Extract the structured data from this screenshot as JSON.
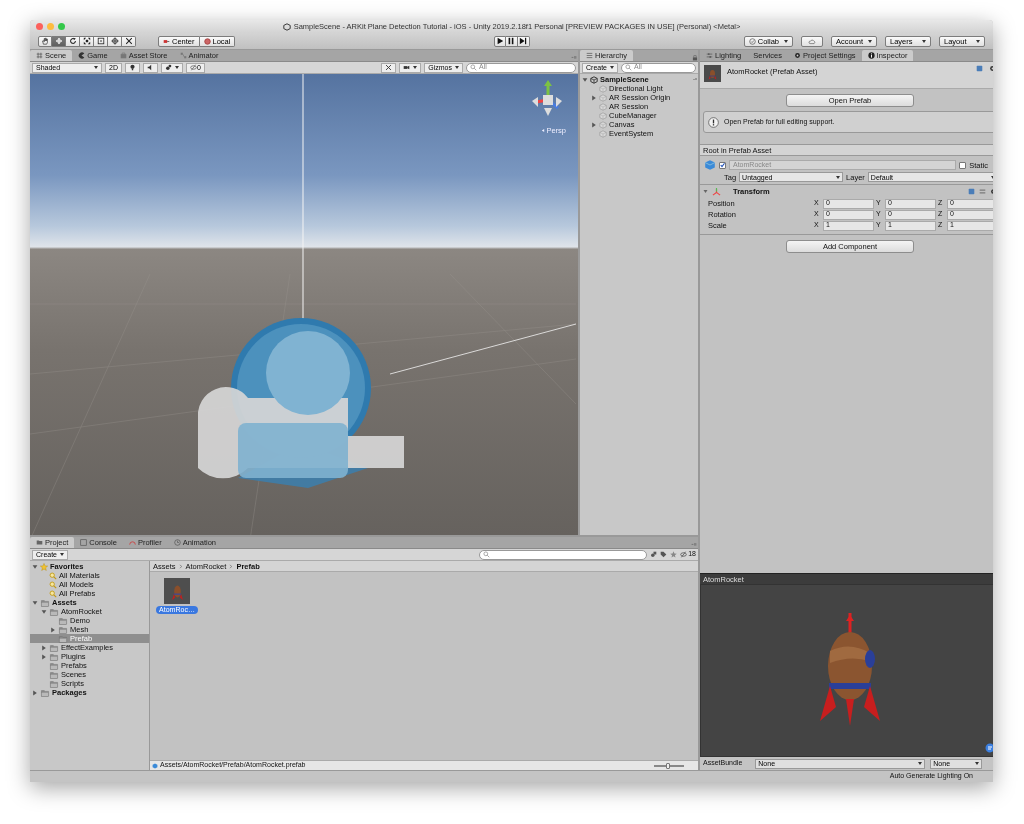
{
  "window": {
    "title": "SampleScene - ARKit Plane Detection Tutorial - iOS - Unity 2019.2.18f1 Personal [PREVIEW PACKAGES IN USE] (Personal) <Metal>"
  },
  "toolbar": {
    "tools": [
      {
        "kind": "hand",
        "selected": false
      },
      {
        "kind": "move",
        "selected": true
      },
      {
        "kind": "rotate",
        "selected": false
      },
      {
        "kind": "scale",
        "selected": false
      },
      {
        "kind": "rect",
        "selected": false
      },
      {
        "kind": "transform",
        "selected": false
      },
      {
        "kind": "custom",
        "selected": false
      }
    ],
    "pivot": [
      "Center",
      "Local"
    ],
    "collab": "Collab",
    "account": "Account",
    "layers": "Layers",
    "layout": "Layout"
  },
  "scene_tabs": [
    {
      "label": "Scene",
      "selected": true
    },
    {
      "label": "Game",
      "selected": false
    },
    {
      "label": "Asset Store",
      "selected": false
    },
    {
      "label": "Animator",
      "selected": false
    }
  ],
  "scene_toolbar": {
    "shading": "Shaded",
    "mode_2d": "2D",
    "hidden_count": "0",
    "gizmos": "Gizmos",
    "search_placeholder": "All"
  },
  "scene_view": {
    "persp": "Persp"
  },
  "hierarchy": {
    "tab": "Hierarchy",
    "create": "Create",
    "search_placeholder": "All",
    "tree": [
      {
        "label": "SampleScene",
        "expandable": true,
        "expanded": true,
        "selected": false,
        "children": [
          {
            "label": "Directional Light",
            "expandable": false,
            "selected": false
          },
          {
            "label": "AR Session Origin",
            "expandable": true,
            "expanded": false,
            "selected": false
          },
          {
            "label": "AR Session",
            "expandable": false,
            "selected": false
          },
          {
            "label": "CubeManager",
            "expandable": false,
            "selected": false
          },
          {
            "label": "Canvas",
            "expandable": true,
            "expanded": false,
            "selected": false
          },
          {
            "label": "EventSystem",
            "expandable": false,
            "selected": false
          }
        ]
      }
    ]
  },
  "inspector_tabs": [
    {
      "label": "Lighting",
      "selected": false
    },
    {
      "label": "Services",
      "selected": false
    },
    {
      "label": "Project Settings",
      "selected": false
    },
    {
      "label": "Inspector",
      "selected": true
    }
  ],
  "inspector": {
    "title": "AtomRocket (Prefab Asset)",
    "open_button": "Open Prefab",
    "info": "Open Prefab for full editing support.",
    "root_label": "Root in Prefab Asset",
    "object_name": "AtomRocket",
    "active": true,
    "static_label": "Static",
    "static": false,
    "tag_label": "Tag",
    "tag": "Untagged",
    "layer_label": "Layer",
    "layer": "Default",
    "component": "Transform",
    "rows": [
      {
        "label": "Position",
        "values": [
          {
            "axis": "X",
            "value": "0"
          },
          {
            "axis": "Y",
            "value": "0"
          },
          {
            "axis": "Z",
            "value": "0"
          }
        ]
      },
      {
        "label": "Rotation",
        "values": [
          {
            "axis": "X",
            "value": "0"
          },
          {
            "axis": "Y",
            "value": "0"
          },
          {
            "axis": "Z",
            "value": "0"
          }
        ]
      },
      {
        "label": "Scale",
        "values": [
          {
            "axis": "X",
            "value": "1"
          },
          {
            "axis": "Y",
            "value": "1"
          },
          {
            "axis": "Z",
            "value": "1"
          }
        ]
      }
    ],
    "add_button": "Add Component"
  },
  "project_tabs": [
    {
      "label": "Project",
      "selected": true
    },
    {
      "label": "Console",
      "selected": false
    },
    {
      "label": "Profiler",
      "selected": false
    },
    {
      "label": "Animation",
      "selected": false
    }
  ],
  "project": {
    "create": "Create",
    "hidden_count": "18",
    "tree": [
      {
        "label": "Favorites",
        "kind": "favorites",
        "expandable": true,
        "expanded": true,
        "selected": false,
        "children": [
          {
            "label": "All Materials",
            "kind": "search",
            "expandable": false,
            "selected": false
          },
          {
            "label": "All Models",
            "kind": "search",
            "expandable": false,
            "selected": false
          },
          {
            "label": "All Prefabs",
            "kind": "search",
            "expandable": false,
            "selected": false
          }
        ]
      },
      {
        "label": "Assets",
        "kind": "root",
        "expandable": true,
        "expanded": true,
        "selected": false,
        "children": [
          {
            "label": "AtomRocket",
            "kind": "folder",
            "expandable": true,
            "expanded": true,
            "selected": false,
            "children": [
              {
                "label": "Demo",
                "kind": "folder",
                "expandable": false,
                "selected": false
              },
              {
                "label": "Mesh",
                "kind": "folder",
                "expandable": true,
                "expanded": false,
                "selected": false
              },
              {
                "label": "Prefab",
                "kind": "folder",
                "expandable": false,
                "selected": true
              }
            ]
          },
          {
            "label": "EffectExamples",
            "kind": "folder",
            "expandable": true,
            "expanded": false,
            "selected": false
          },
          {
            "label": "Plugins",
            "kind": "folder",
            "expandable": true,
            "expanded": false,
            "selected": false
          },
          {
            "label": "Prefabs",
            "kind": "folder",
            "expandable": false,
            "selected": false
          },
          {
            "label": "Scenes",
            "kind": "folder",
            "expandable": false,
            "selected": false
          },
          {
            "label": "Scripts",
            "kind": "folder",
            "expandable": false,
            "selected": false
          }
        ]
      },
      {
        "label": "Packages",
        "kind": "root",
        "expandable": true,
        "expanded": false,
        "selected": false
      }
    ],
    "breadcrumb": [
      "Assets",
      "AtomRocket",
      "Prefab"
    ],
    "assets": [
      {
        "label": "AtomRoc…",
        "selected": true
      }
    ],
    "path": "Assets/AtomRocket/Prefab/AtomRocket.prefab",
    "zoom_slider": {
      "level": 0.45
    }
  },
  "preview": {
    "title": "AtomRocket",
    "bundle_label": "AssetBundle",
    "bundle": "None",
    "variant": "None"
  },
  "status_bar": {
    "text": "Auto Generate Lighting On"
  }
}
